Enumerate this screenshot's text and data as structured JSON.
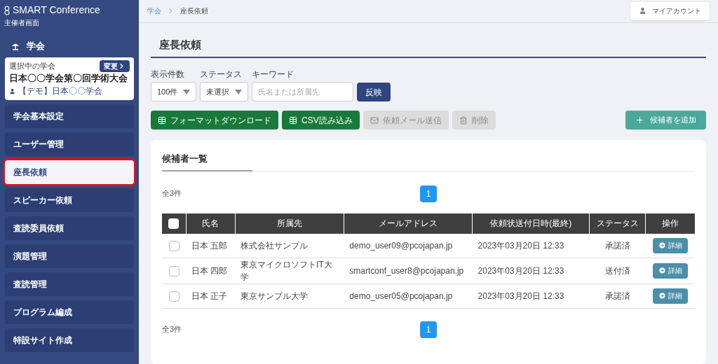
{
  "brand": {
    "name": "SMART Conference",
    "subtitle": "主催者画面"
  },
  "sidebar": {
    "section": "学会",
    "current": {
      "label": "選択中の学会",
      "change": "変更",
      "name": "日本〇〇学会第〇回学術大会",
      "org": "【デモ】日本〇〇学会"
    },
    "items": [
      {
        "label": "学会基本設定",
        "selected": false
      },
      {
        "label": "ユーザー管理",
        "selected": false
      },
      {
        "label": "座長依頼",
        "selected": true
      },
      {
        "label": "スピーカー依頼",
        "selected": false
      },
      {
        "label": "査読委員依頼",
        "selected": false
      },
      {
        "label": "演題管理",
        "selected": false
      },
      {
        "label": "査読管理",
        "selected": false
      },
      {
        "label": "プログラム編成",
        "selected": false
      },
      {
        "label": "特設サイト作成",
        "selected": false
      }
    ]
  },
  "breadcrumb": [
    {
      "label": "学会",
      "link": true
    },
    {
      "label": "座長依頼",
      "link": false
    }
  ],
  "account": "マイアカウント",
  "title": "座長依頼",
  "filters": [
    {
      "label": "表示件数",
      "kind": "select",
      "value": "100件"
    },
    {
      "label": "ステータス",
      "kind": "select",
      "value": "未選択"
    },
    {
      "label": "キーワード",
      "kind": "input",
      "placeholder": "氏名または所属先"
    }
  ],
  "apply": "反映",
  "actions": [
    {
      "label": "フォーマットダウンロード",
      "disabled": false
    },
    {
      "label": "CSV読み込み",
      "disabled": false
    },
    {
      "label": "依頼メール送信",
      "disabled": true
    },
    {
      "label": "削除",
      "disabled": true
    }
  ],
  "add": "候補者を追加",
  "panel": {
    "title": "候補者一覧",
    "count_top": "全3件",
    "count_bottom": "全3件",
    "pages_top": [
      {
        "label": "1",
        "selected": true
      }
    ],
    "pages_bottom": [
      {
        "label": "1",
        "selected": true
      }
    ],
    "select_all_checked": false,
    "columns": [
      "氏名",
      "所属先",
      "メールアドレス",
      "依頼状送付日時(最終)",
      "ステータス",
      "操作"
    ],
    "rows": [
      {
        "checked": false,
        "name": "日本 五郎",
        "affiliation": "株式会社サンプル",
        "email": "demo_user09@pcojapan.jp",
        "sent": "2023年03月20日 12:33",
        "status": "承諾済",
        "action": "詳細"
      },
      {
        "checked": false,
        "name": "日本 四郎",
        "affiliation": "東京マイクロソフトIT大学",
        "email": "smartconf_user8@pcojapan.jp",
        "sent": "2023年03月20日 12:33",
        "status": "送付済",
        "action": "詳細"
      },
      {
        "checked": false,
        "name": "日本 正子",
        "affiliation": "東京サンプル大学",
        "email": "demo_user05@pcojapan.jp",
        "sent": "2023年03月20日 12:33",
        "status": "承諾済",
        "action": "詳細"
      }
    ]
  }
}
